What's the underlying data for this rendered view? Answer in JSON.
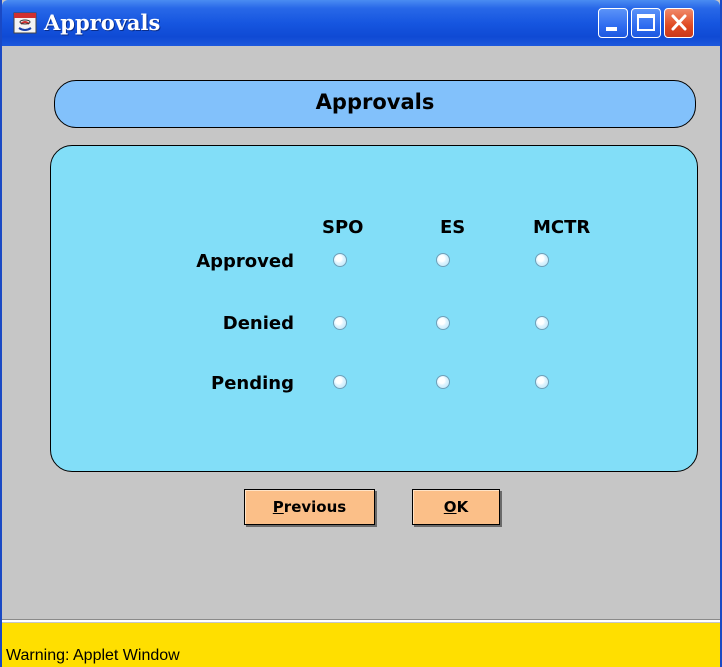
{
  "window": {
    "title": "Approvals",
    "icons": {
      "app": "java-applet-icon",
      "minimize": "minimize-icon",
      "maximize": "maximize-icon",
      "close": "close-icon"
    }
  },
  "header": {
    "title": "Approvals"
  },
  "approvals": {
    "columns": [
      "SPO",
      "ES",
      "MCTR"
    ],
    "rows": [
      {
        "label": "Approved"
      },
      {
        "label": "Denied"
      },
      {
        "label": "Pending"
      }
    ],
    "selected": null
  },
  "buttons": {
    "previous": {
      "mnemonic": "P",
      "rest": "revious"
    },
    "ok": {
      "mnemonic": "O",
      "rest": "K"
    }
  },
  "status": {
    "text": "Warning: Applet Window"
  },
  "colors": {
    "title_bar": "#1656e0",
    "header_panel": "#82c1fb",
    "main_panel": "#82def8",
    "button": "#fbbf88",
    "window_bg": "#c6c6c6",
    "status_bar": "#ffdf00"
  }
}
